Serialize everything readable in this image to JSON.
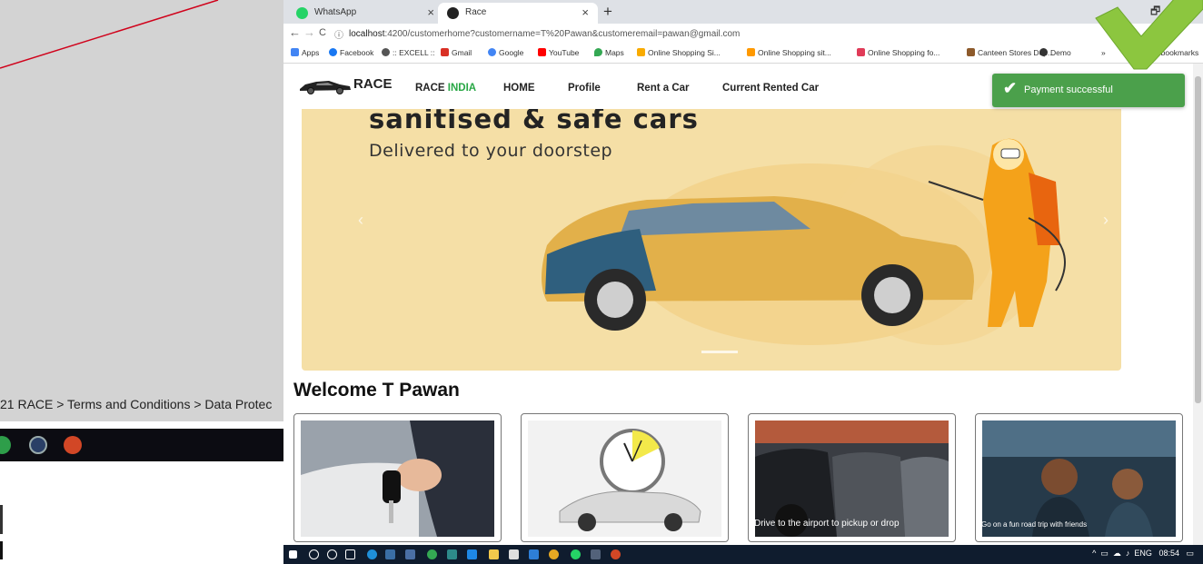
{
  "background_window": {
    "breadcrumb": "21 RACE > Terms and Conditions > Data Protec"
  },
  "browser": {
    "tabs": [
      {
        "label": "WhatsApp",
        "active": false
      },
      {
        "label": "Race",
        "active": true
      }
    ],
    "new_tab": "+",
    "minimize": "🗗",
    "url_host": "localhost",
    "url_rest": ":4200/customerhome?customername=T%20Pawan&customeremail=pawan@gmail.com",
    "nav": {
      "back": "←",
      "forward": "→",
      "reload": "C",
      "info": "ⓘ"
    },
    "bookmarks": [
      {
        "label": "Apps",
        "color": "#4285f4"
      },
      {
        "label": "Facebook",
        "color": "#1877f2"
      },
      {
        "label": ":: EXCELL ::",
        "color": "#555555"
      },
      {
        "label": "Gmail",
        "color": "#d93025"
      },
      {
        "label": "Google",
        "color": "#4285f4"
      },
      {
        "label": "YouTube",
        "color": "#ff0000"
      },
      {
        "label": "Maps",
        "color": "#34a853"
      },
      {
        "label": "Online Shopping Si...",
        "color": "#f9ab00"
      },
      {
        "label": "Online Shopping sit...",
        "color": "#ff9900"
      },
      {
        "label": "Online Shopping fo...",
        "color": "#e03b58"
      },
      {
        "label": "Canteen Stores Dep...",
        "color": "#8d5a2b"
      },
      {
        "label": "Demo",
        "color": "#333333"
      },
      {
        "label": "»",
        "color": "transparent"
      },
      {
        "label": "Other bookmarks",
        "color": "#f2c94c"
      }
    ]
  },
  "site": {
    "logo": "RACE",
    "nav": {
      "race": "RACE",
      "india": "INDIA",
      "home": "HOME",
      "profile": "Profile",
      "rent": "Rent a Car",
      "current": "Current Rented Car"
    },
    "hero": {
      "title": "sanitised & safe cars",
      "subtitle": "Delivered to your doorstep",
      "prev": "‹",
      "next": "›"
    },
    "welcome": "Welcome T Pawan",
    "cards": [
      {
        "caption": ""
      },
      {
        "caption": ""
      },
      {
        "caption": "Drive to the airport to pickup or drop"
      },
      {
        "caption": "Go on a fun road trip with friends"
      }
    ]
  },
  "toast": {
    "icon": "✔",
    "message": "Payment successful",
    "color": "#4ba04b"
  },
  "taskbar": {
    "lang": "ENG",
    "time": "08:54"
  }
}
